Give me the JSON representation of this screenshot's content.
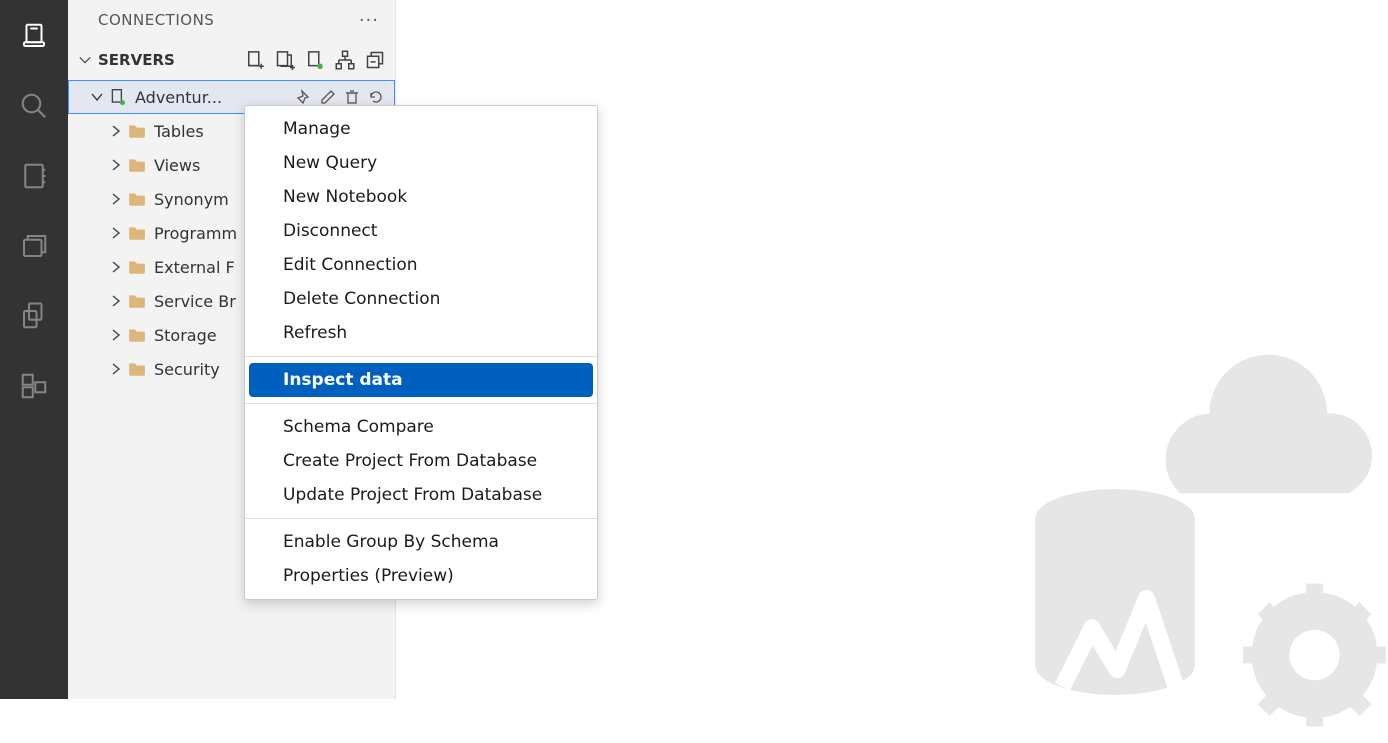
{
  "sidebar": {
    "title": "CONNECTIONS",
    "section": "SERVERS",
    "server_name": "Adventur...",
    "tree_items": [
      {
        "label": "Tables"
      },
      {
        "label": "Views"
      },
      {
        "label": "Synonym"
      },
      {
        "label": "Programm"
      },
      {
        "label": "External F"
      },
      {
        "label": "Service Br"
      },
      {
        "label": "Storage"
      },
      {
        "label": "Security"
      }
    ]
  },
  "context_menu": {
    "groups": [
      [
        "Manage",
        "New Query",
        "New Notebook",
        "Disconnect",
        "Edit Connection",
        "Delete Connection",
        "Refresh"
      ],
      [
        "Inspect data"
      ],
      [
        "Schema Compare",
        "Create Project From Database",
        "Update Project From Database"
      ],
      [
        "Enable Group By Schema",
        "Properties (Preview)"
      ]
    ],
    "highlighted": "Inspect data"
  }
}
